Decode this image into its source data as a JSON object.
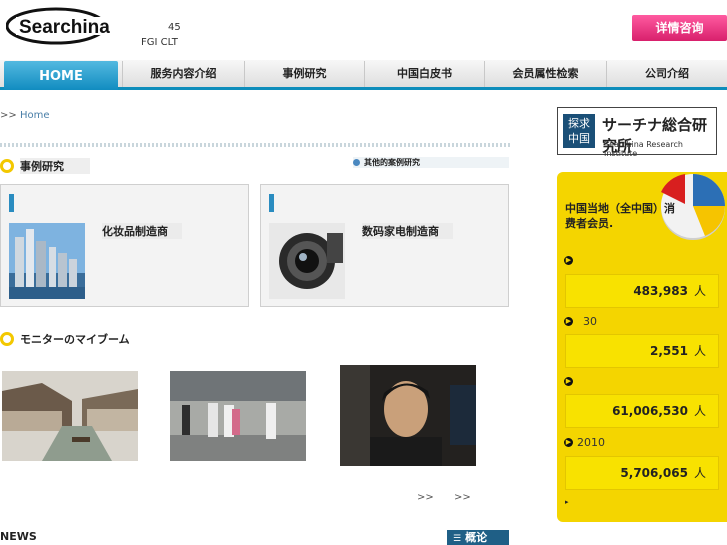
{
  "header": {
    "logo_text": "Searchina",
    "num_text": "45",
    "sub_text": "FGI CLT",
    "consult_button": "详情咨询"
  },
  "nav": {
    "home": "HOME",
    "items": [
      "服务内容介绍",
      "事例研究",
      "中国白皮书",
      "会员属性检索",
      "公司介绍"
    ]
  },
  "breadcrumb": {
    "prefix": ">>",
    "link": "Home"
  },
  "cases": {
    "title": "事例研究",
    "more_link": "其他的案例研究",
    "cards": [
      {
        "label": "化妆品制造商"
      },
      {
        "label": "数码家电制造商"
      }
    ]
  },
  "monitor": {
    "title": "モニターのマイブーム",
    "pager": [
      ">>",
      ">>"
    ]
  },
  "news": {
    "title": "NEWS",
    "overview_button": "概论"
  },
  "sidebar": {
    "brand_mark": "探求中国",
    "brand_jp": "サーチナ総合研究所",
    "brand_en": "Searchina Research Institute",
    "panel_title": "中国当地（全中国）消费者会员.",
    "rows": [
      {
        "label": "",
        "value": "483,983",
        "unit": "人"
      },
      {
        "label": "30",
        "value": "2,551",
        "unit": "人"
      },
      {
        "label": "",
        "value": "61,006,530",
        "unit": "人"
      },
      {
        "label": "2010",
        "value": "5,706,065",
        "unit": "人"
      }
    ]
  }
}
